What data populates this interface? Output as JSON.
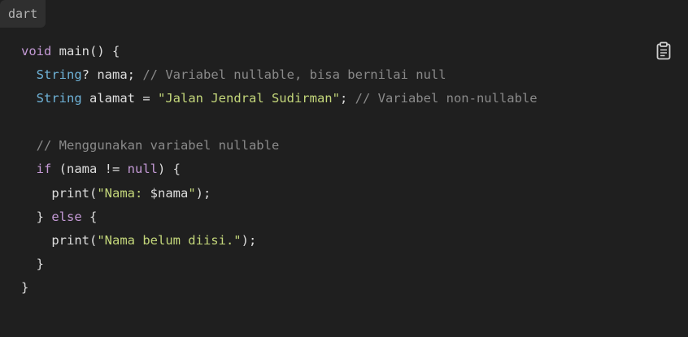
{
  "language_label": "dart",
  "copy_icon": "clipboard-icon",
  "code_lines": [
    [
      {
        "t": "void",
        "c": "kw"
      },
      {
        "t": " main() {",
        "c": "fn"
      }
    ],
    [
      {
        "t": "  ",
        "c": "fn"
      },
      {
        "t": "String",
        "c": "type"
      },
      {
        "t": "? nama; ",
        "c": "fn"
      },
      {
        "t": "// Variabel nullable, bisa bernilai null",
        "c": "cmt"
      }
    ],
    [
      {
        "t": "  ",
        "c": "fn"
      },
      {
        "t": "String",
        "c": "type"
      },
      {
        "t": " alamat = ",
        "c": "fn"
      },
      {
        "t": "\"Jalan Jendral Sudirman\"",
        "c": "str"
      },
      {
        "t": "; ",
        "c": "fn"
      },
      {
        "t": "// Variabel non-nullable",
        "c": "cmt"
      }
    ],
    [],
    [
      {
        "t": "  ",
        "c": "fn"
      },
      {
        "t": "// Menggunakan variabel nullable",
        "c": "cmt"
      }
    ],
    [
      {
        "t": "  ",
        "c": "fn"
      },
      {
        "t": "if",
        "c": "kw"
      },
      {
        "t": " (nama != ",
        "c": "fn"
      },
      {
        "t": "null",
        "c": "null"
      },
      {
        "t": ") {",
        "c": "fn"
      }
    ],
    [
      {
        "t": "    print(",
        "c": "fn"
      },
      {
        "t": "\"Nama: ",
        "c": "str"
      },
      {
        "t": "$nama",
        "c": "fn"
      },
      {
        "t": "\"",
        "c": "str"
      },
      {
        "t": ");",
        "c": "fn"
      }
    ],
    [
      {
        "t": "  } ",
        "c": "fn"
      },
      {
        "t": "else",
        "c": "kw"
      },
      {
        "t": " {",
        "c": "fn"
      }
    ],
    [
      {
        "t": "    print(",
        "c": "fn"
      },
      {
        "t": "\"Nama belum diisi.\"",
        "c": "str"
      },
      {
        "t": ");",
        "c": "fn"
      }
    ],
    [
      {
        "t": "  }",
        "c": "fn"
      }
    ],
    [
      {
        "t": "}",
        "c": "fn"
      }
    ]
  ]
}
